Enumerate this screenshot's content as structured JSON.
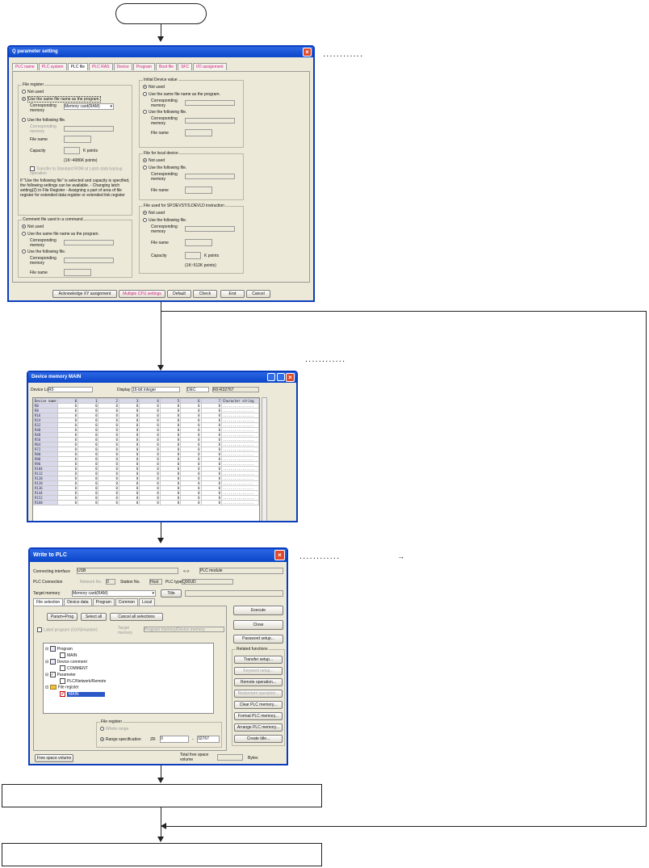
{
  "qparam": {
    "title": "Q parameter setting",
    "tabs": [
      "PLC name",
      "PLC system",
      "PLC file",
      "PLC RAS",
      "Device",
      "Program",
      "Boot file",
      "SFC",
      "I/O assignment"
    ],
    "file_register": {
      "label": "File register",
      "opt_not_used": "Not used",
      "opt_same_name": "Use the same file name as the program.",
      "corresponding_memory": "Corresponding memory",
      "memory_value": "Memory card(RAM)",
      "opt_following": "Use the following file.",
      "file_name": "File name",
      "capacity": "Capacity",
      "k_points": "K points",
      "range": "(1K~4086K points)",
      "transfer": "Transfer to Standard ROM at Latch data backup operation",
      "note": "If \"Use the following file\" is selected and capacity is specified, the following settings can be available. - Changing latch setting(2) in File Register - Assigning a part of area of file register for extended data register or extended link register"
    },
    "comment_file": {
      "label": "Comment file used in a command",
      "opt_not_used": "Not used",
      "opt_same_name": "Use the same file name as the program.",
      "corresponding_memory": "Corresponding memory",
      "opt_following": "Use the following file.",
      "file_name": "File name"
    },
    "initial_device": {
      "label": "Initial Device value",
      "opt_not_used": "Not used",
      "opt_same_name": "Use the same file name as the program.",
      "corresponding_memory": "Corresponding memory",
      "opt_following": "Use the following file.",
      "file_name": "File name"
    },
    "local_device": {
      "label": "File for local device",
      "opt_not_used": "Not used",
      "opt_following": "Use the following file.",
      "corresponding_memory": "Corresponding memory",
      "file_name": "File name"
    },
    "sp_devst": {
      "label": "File used for SP.DEVST/S.DEVLD instruction",
      "opt_not_used": "Not used",
      "opt_following": "Use the following file.",
      "corresponding_memory": "Corresponding memory",
      "file_name": "File name",
      "capacity": "Capacity",
      "k_points": "K points",
      "range": "(1K~512K points)"
    },
    "buttons": [
      "Acknowledge XY assignment",
      "Multiple CPU settings",
      "Default",
      "Check",
      "End",
      "Cancel"
    ]
  },
  "devmem": {
    "title": "Device memory MAIN",
    "device_label_caption": "Device Label",
    "device_label_value": "R0",
    "display_caption": "Display",
    "display_value": "16-bit integer",
    "radix_value": "DEC",
    "range_value": "R0-R32767",
    "col_header": "Device name",
    "cols": [
      "0",
      "1",
      "2",
      "3",
      "4",
      "5",
      "6",
      "7"
    ],
    "char_header": "Character string",
    "rows": [
      "R0",
      "R8",
      "R16",
      "R24",
      "R32",
      "R40",
      "R48",
      "R56",
      "R64",
      "R72",
      "R80",
      "R88",
      "R96",
      "R104",
      "R112",
      "R120",
      "R128",
      "R136",
      "R144",
      "R152",
      "R160"
    ],
    "cell_value": "0",
    "char_value": "................"
  },
  "write": {
    "title": "Write to PLC",
    "connecting_interface": "Connecting interface",
    "interface_value": "USB",
    "arrow": "<->",
    "plc_module": "PLC module",
    "plc_connection": "PLC Connection",
    "network_no": "Network No.",
    "network_value": "0",
    "station_no": "Station No.",
    "station_value": "Host",
    "plc_type": "PLC type",
    "plc_type_value": "Q00UD",
    "target_memory": "Target memory",
    "target_value": "Memory card(RAM)",
    "title_btn": "Title",
    "tabs": [
      "File selection",
      "Device data",
      "Program",
      "Common",
      "Local"
    ],
    "param_prog": "Param+Prog",
    "select_all": "Select all",
    "cancel_all": "Cancel all selections",
    "label_program": "Label program (GX/Simulator)",
    "target_memory_small": "Target memory",
    "target_memory_small_value": "Program memory/Device memory",
    "tree": {
      "program": "Program",
      "main": "MAIN",
      "device_comment": "Device comment",
      "comment": "COMMENT",
      "parameter": "Parameter",
      "plc_network": "PLC/Network/Remote",
      "file_register": "File register",
      "main2": "MAIN"
    },
    "fr_group": "File register",
    "whole_range": "Whole range",
    "range_spec": "Range specification",
    "zr": "ZR",
    "from": "0",
    "dash": "-",
    "to": "32767",
    "free_space": "Free space volume",
    "total_free": "Total free space volume",
    "bytes": "Bytes",
    "execute": "Execute",
    "close": "Close",
    "password_setup": "Password setup...",
    "related": "Related functions",
    "related_buttons": [
      "Transfer setup...",
      "Keyword setup...",
      "Remote operation...",
      "Redundant operation...",
      "Clear PLC memory...",
      "Format PLC memory...",
      "Arrange PLC memory...",
      "Create title..."
    ]
  },
  "callout_dots": "............",
  "callout_arrow": "→"
}
